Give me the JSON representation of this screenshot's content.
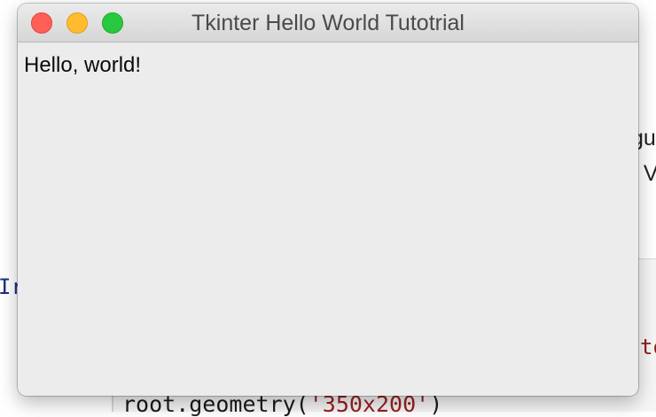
{
  "window": {
    "title": "Tkinter Hello World Tutotrial",
    "label_text": "Hello, world!"
  },
  "background": {
    "fragments": [
      "gu",
      ". V",
      "Ir",
      "to"
    ],
    "code_line": {
      "prefix": "root.geometry(",
      "string": "'350x200'",
      "suffix": ")"
    }
  },
  "colors": {
    "traffic_close": "#fe5f57",
    "traffic_minimize": "#febc2e",
    "traffic_maximize": "#28c840",
    "window_background": "#ececec",
    "code_string": "#9a1f1f",
    "code_keyword": "#1c2e80"
  },
  "icons": {
    "close": "close-icon",
    "minimize": "minimize-icon",
    "maximize": "maximize-icon"
  }
}
